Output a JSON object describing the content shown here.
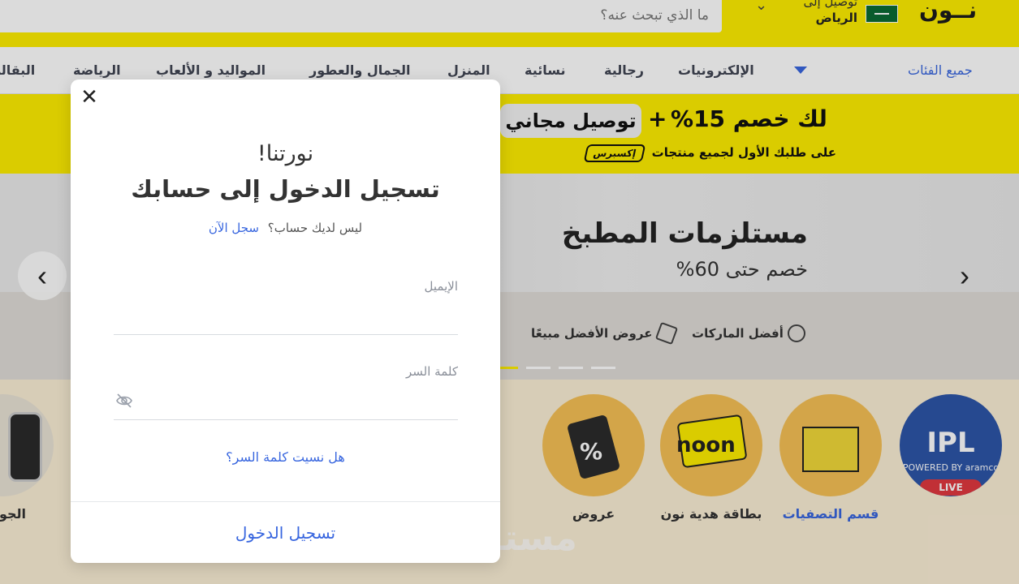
{
  "header": {
    "logo": "نــون",
    "deliver_label": "توصيل إلى",
    "deliver_city": "الرياض",
    "search_placeholder": "ما الذي تبحث عنه؟"
  },
  "nav": {
    "all_categories": "جميع الفئات",
    "items": [
      "الإلكترونيات",
      "رجالية",
      "نسائية",
      "المنزل",
      "الجمال والعطور",
      "المواليد و الألعاب",
      "الرياضة",
      "البقالة"
    ]
  },
  "promo": {
    "main": "لك خصم 15%",
    "plus": "+",
    "pill": "توصيل مجاني",
    "sub": "على طلبك الأول لجميع منتجات",
    "express": "إكسبرس"
  },
  "hero": {
    "title": "مستلزمات المطبخ",
    "subtitle": "خصم حتى 60%",
    "badges": [
      "أفضل الماركات",
      "عروض الأفضل مبيعًا"
    ]
  },
  "circles": [
    {
      "label": "IPL",
      "sub": "POWERED BY aramco",
      "live": "LIVE"
    },
    {
      "label": "قسم التصفيات"
    },
    {
      "label": "بطاقة هدية نون",
      "card_text": "noon"
    },
    {
      "label": "عروض",
      "tag_text": "%"
    },
    {
      "label": "الجو"
    }
  ],
  "modal": {
    "greeting": "نورتنا!",
    "title": "تسجيل الدخول إلى حسابك",
    "no_account": "ليس لديك حساب؟",
    "signup_link": "سجل الآن",
    "email_label": "الإيميل",
    "password_label": "كلمة السر",
    "forgot": "هل نسيت كلمة السر؟",
    "submit": "تسجيل الدخول"
  },
  "watermark": "مستقل",
  "colors": {
    "brand_yellow": "#feee00",
    "link_blue": "#3866df"
  }
}
